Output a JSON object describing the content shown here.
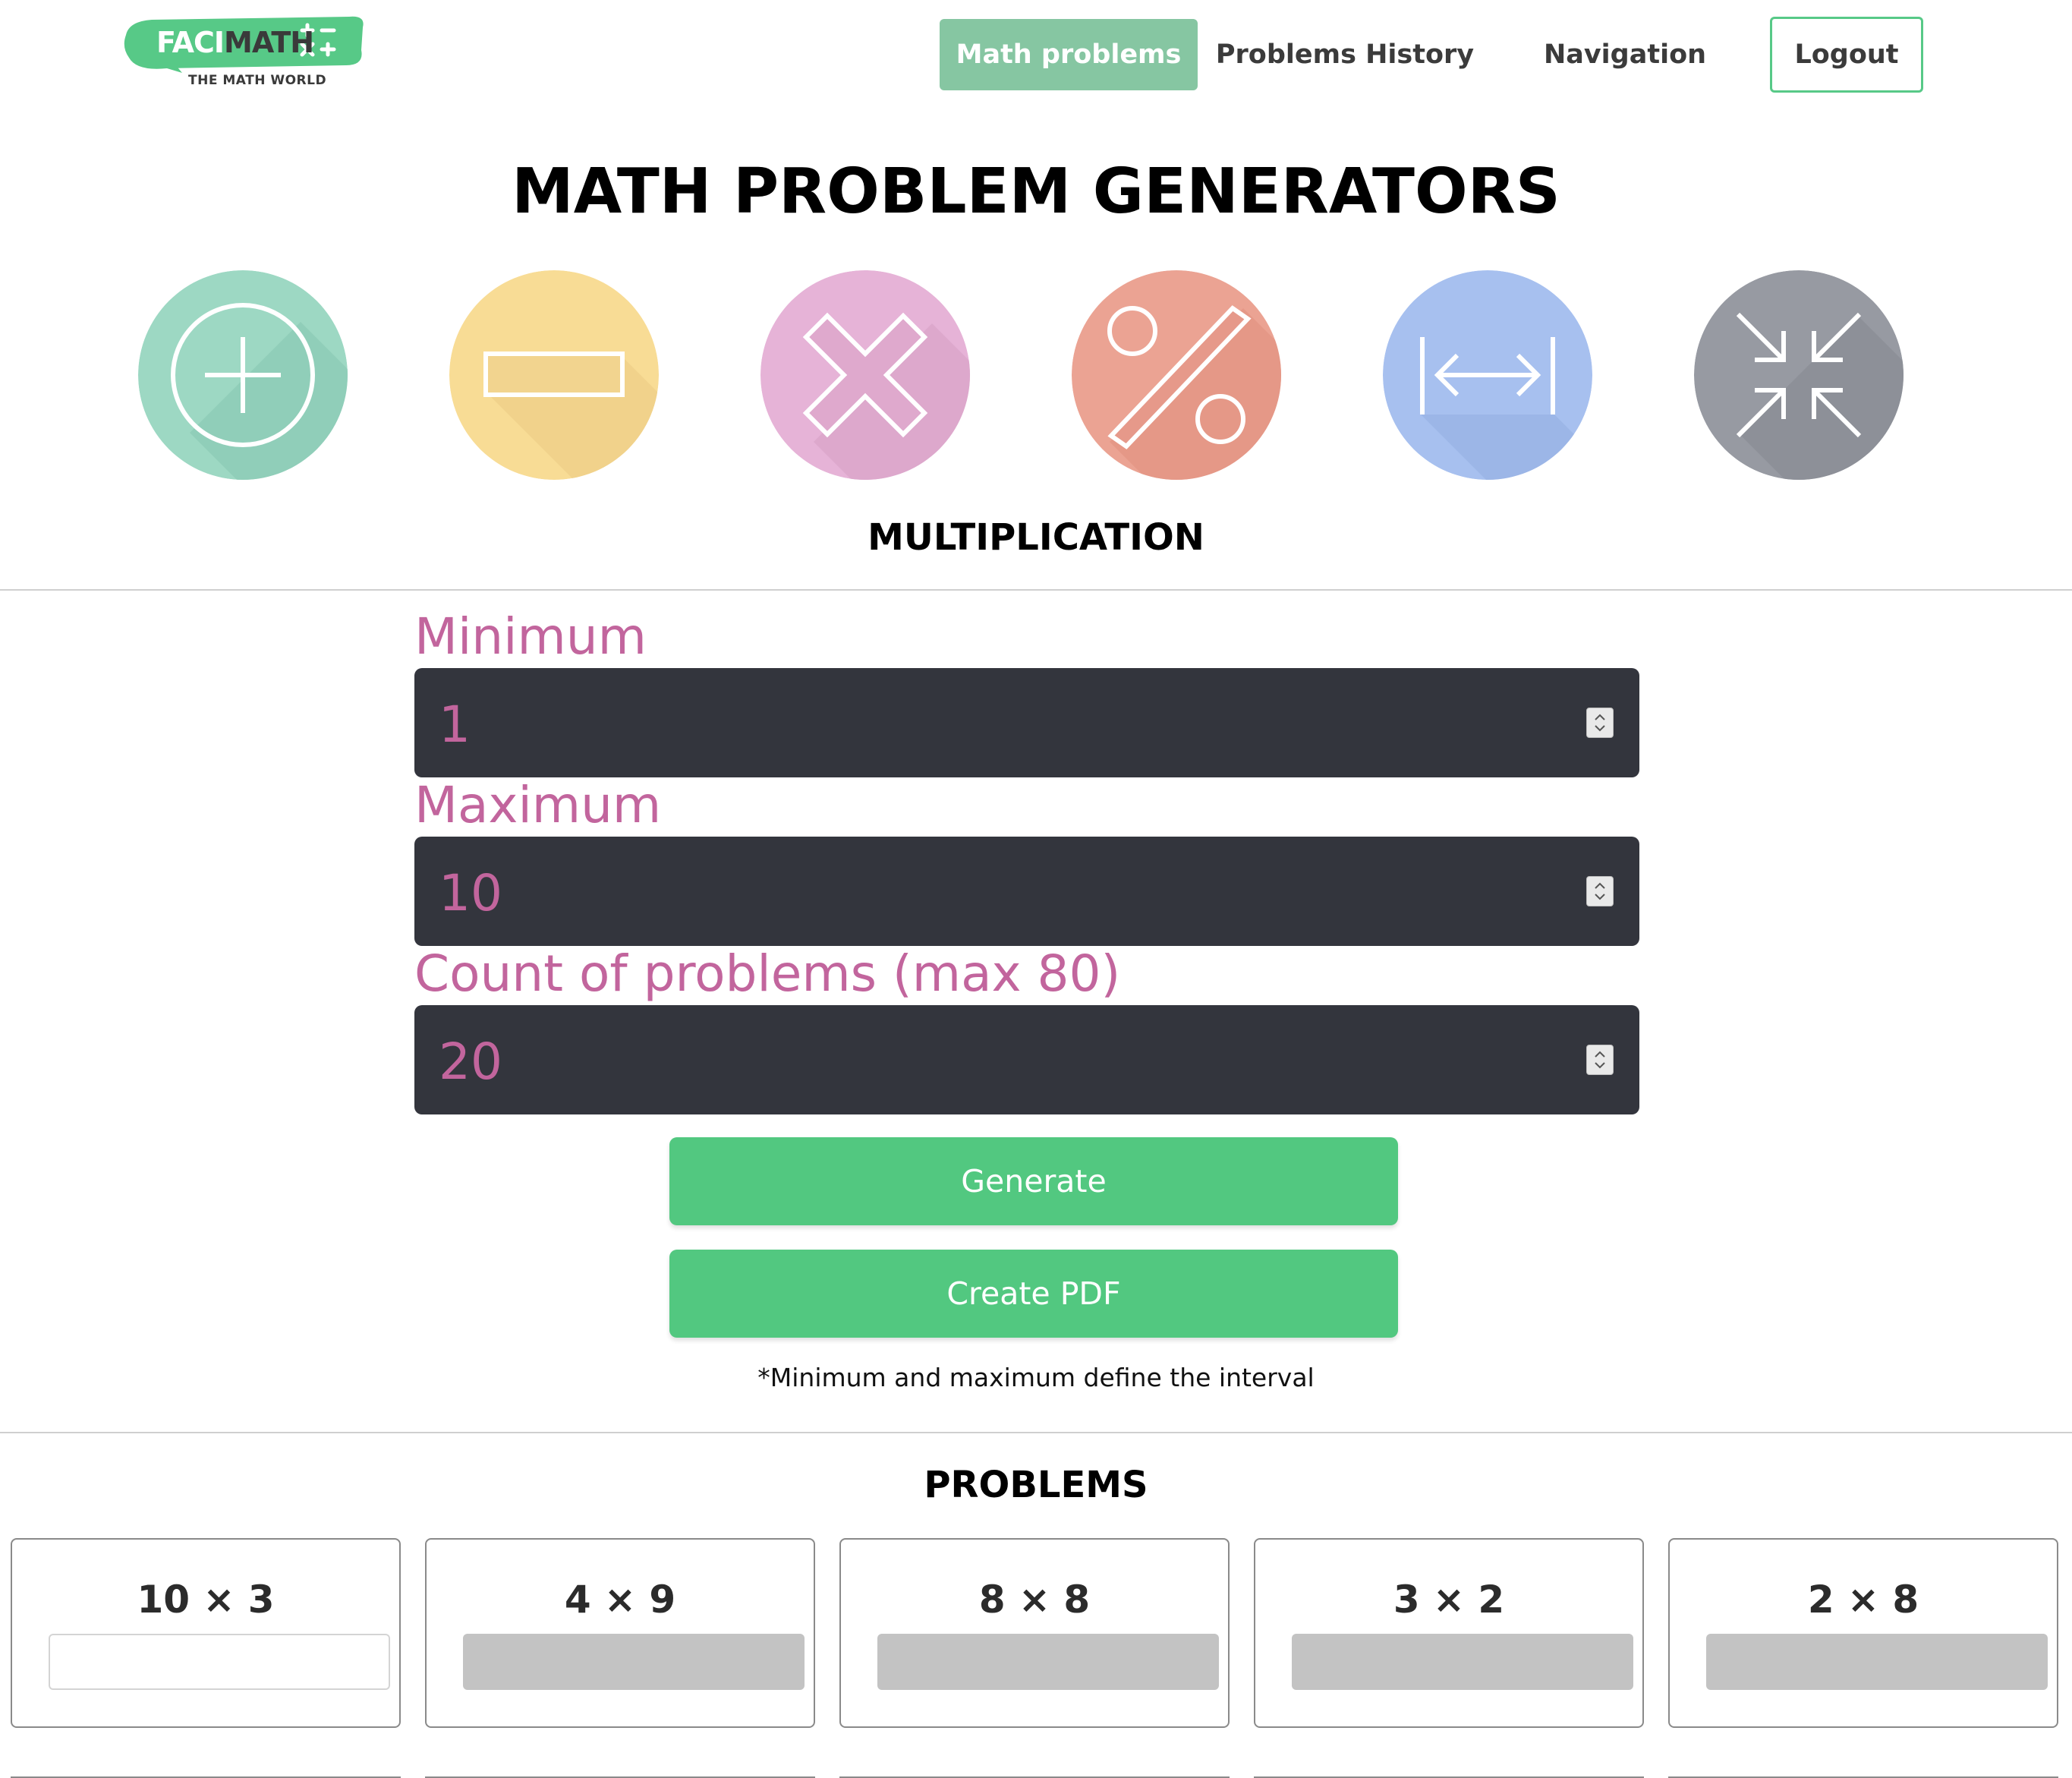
{
  "brand": {
    "name_part1": "FACI",
    "name_part2": "MATH",
    "tagline": "THE MATH WORLD",
    "color": "#57c987"
  },
  "nav": {
    "items": [
      {
        "label": "Math problems",
        "active": true
      },
      {
        "label": "Problems History",
        "active": false
      },
      {
        "label": "Navigation",
        "active": false
      }
    ],
    "logout_label": "Logout"
  },
  "page": {
    "title": "MATH PROBLEM GENERATORS",
    "selected_operation": "MULTIPLICATION"
  },
  "operations": [
    {
      "icon": "plus-icon",
      "color": "#9dd8c3"
    },
    {
      "icon": "minus-icon",
      "color": "#f8dc95"
    },
    {
      "icon": "multiply-icon",
      "color": "#e6b3d7"
    },
    {
      "icon": "percent-icon",
      "color": "#eba393"
    },
    {
      "icon": "interval-icon",
      "color": "#a7c0ef"
    },
    {
      "icon": "compress-icon",
      "color": "#979aa2"
    }
  ],
  "form": {
    "minimum_label": "Minimum",
    "minimum_value": "1",
    "maximum_label": "Maximum",
    "maximum_value": "10",
    "count_label": "Count of problems (max 80)",
    "count_value": "20",
    "generate_label": "Generate",
    "pdf_label": "Create PDF",
    "note": "*Minimum and maximum define the interval"
  },
  "problems": {
    "title": "PROBLEMS",
    "items": [
      {
        "expression": "10 × 3"
      },
      {
        "expression": "4 × 9"
      },
      {
        "expression": "8 × 8"
      },
      {
        "expression": "3 × 2"
      },
      {
        "expression": "2 × 8"
      }
    ]
  }
}
